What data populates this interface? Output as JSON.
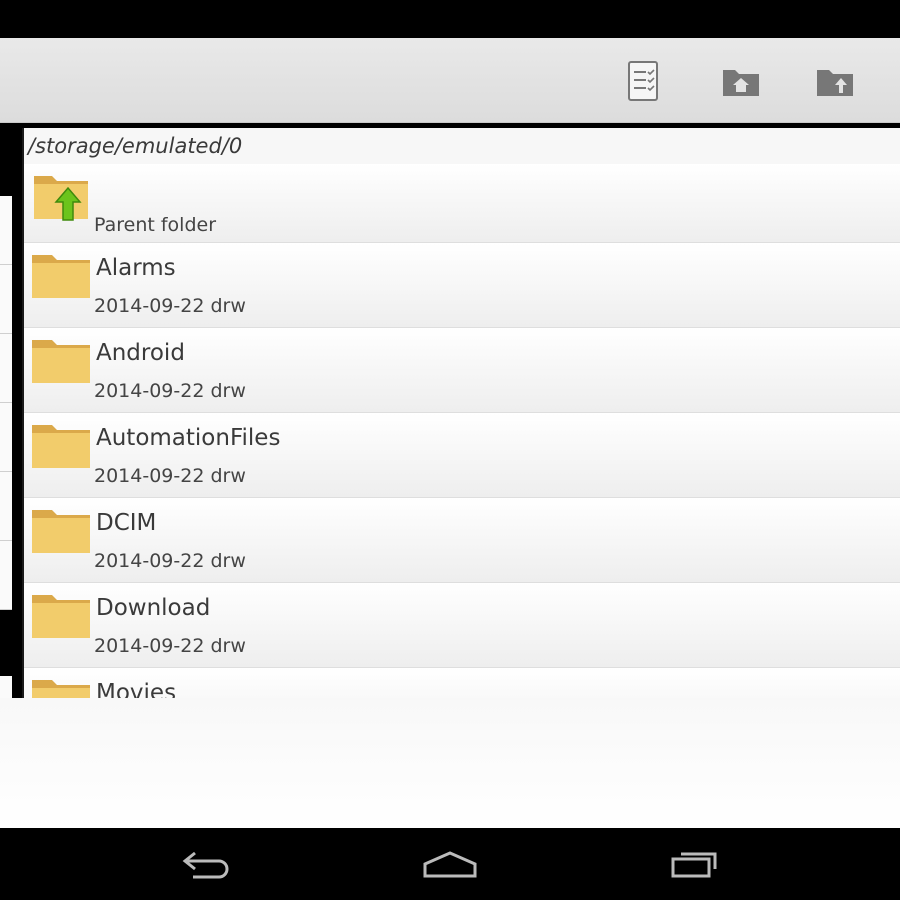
{
  "action_bar": {
    "icons": [
      "checklist-icon",
      "folder-home-icon",
      "folder-upload-icon"
    ]
  },
  "browser": {
    "path": "/storage/emulated/0",
    "parent": {
      "name": "",
      "meta": "Parent folder"
    },
    "items": [
      {
        "name": "Alarms",
        "meta": "2014-09-22 drw"
      },
      {
        "name": "Android",
        "meta": "2014-09-22 drw"
      },
      {
        "name": "AutomationFiles",
        "meta": "2014-09-22 drw"
      },
      {
        "name": "DCIM",
        "meta": "2014-09-22 drw"
      },
      {
        "name": "Download",
        "meta": "2014-09-22 drw"
      },
      {
        "name": "Movies",
        "meta": ""
      }
    ]
  },
  "nav": {
    "icons": [
      "back-icon",
      "home-icon",
      "recents-icon"
    ]
  },
  "colors": {
    "folder": "#f2cc6b",
    "folder_dark": "#dba94a",
    "arrow": "#6cc41c",
    "icon_gray": "#777777"
  }
}
